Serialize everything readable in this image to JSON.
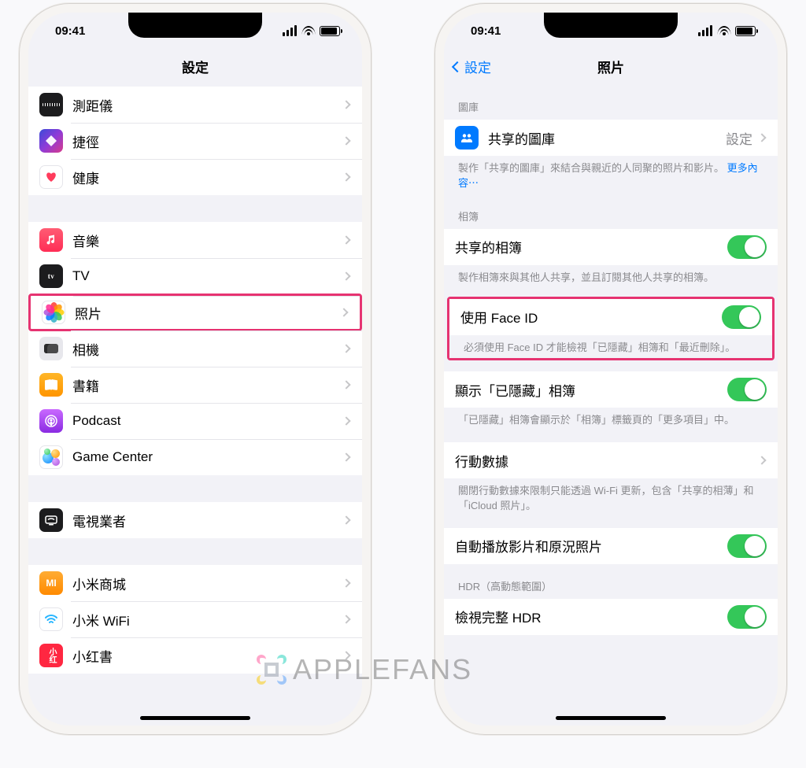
{
  "status": {
    "time": "09:41"
  },
  "watermark": "APPLEFANS",
  "left": {
    "title": "設定",
    "groups": [
      {
        "items": [
          {
            "icon": "measure-icon",
            "label": "測距儀"
          },
          {
            "icon": "shortcuts-icon",
            "label": "捷徑"
          },
          {
            "icon": "health-icon",
            "label": "健康"
          }
        ]
      },
      {
        "items": [
          {
            "icon": "music-icon",
            "label": "音樂"
          },
          {
            "icon": "tv-icon",
            "label": "TV"
          },
          {
            "icon": "photos-icon",
            "label": "照片",
            "highlight": true
          },
          {
            "icon": "camera-icon",
            "label": "相機"
          },
          {
            "icon": "books-icon",
            "label": "書籍"
          },
          {
            "icon": "podcast-icon",
            "label": "Podcast"
          },
          {
            "icon": "gamecenter-icon",
            "label": "Game Center"
          }
        ]
      },
      {
        "items": [
          {
            "icon": "tvprovider-icon",
            "label": "電視業者"
          }
        ]
      },
      {
        "items": [
          {
            "icon": "mi-store-icon",
            "label": "小米商城"
          },
          {
            "icon": "mi-wifi-icon",
            "label": "小米 WiFi"
          },
          {
            "icon": "xhs-icon",
            "label": "小红書"
          }
        ]
      }
    ]
  },
  "right": {
    "back": "設定",
    "title": "照片",
    "sections": {
      "library": {
        "header": "圖庫",
        "item": {
          "label": "共享的圖庫",
          "value": "設定"
        },
        "footer_pre": "製作「共享的圖庫」來結合與親近的人同聚的照片和影片。 ",
        "footer_link": "更多內容⋯"
      },
      "albums": {
        "header": "相簿",
        "shared": {
          "label": "共享的相簿",
          "on": true
        },
        "shared_footer": "製作相簿來與其他人共享，並且訂閱其他人共享的相簿。",
        "faceid": {
          "label": "使用 Face ID",
          "on": true
        },
        "faceid_footer": "必須使用 Face ID 才能檢視「已隱藏」相簿和「最近刪除」。",
        "hidden": {
          "label": "顯示「已隱藏」相簿",
          "on": true
        },
        "hidden_footer": "「已隱藏」相簿會顯示於「相簿」標籤頁的「更多項目」中。",
        "cellular": {
          "label": "行動數據"
        },
        "cellular_footer": "關閉行動數據來限制只能透過 Wi-Fi 更新，包含「共享的相薄」和「iCloud 照片」。",
        "autoplay": {
          "label": "自動播放影片和原況照片",
          "on": true
        }
      },
      "hdr": {
        "header": "HDR（高動態範圍）",
        "full": {
          "label": "檢視完整 HDR",
          "on": true
        }
      }
    }
  }
}
